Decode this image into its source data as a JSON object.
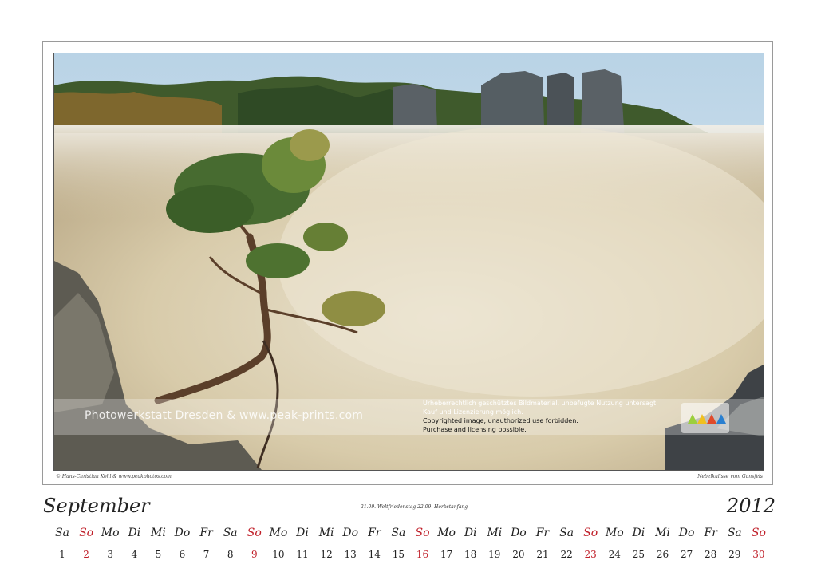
{
  "photo": {
    "watermark_left": "Photowerkstatt Dresden & www.peak-prints.com",
    "notice_de_1": "Urheberrechtlich geschütztes Bildmaterial, unbefugte Nutzung untersagt.",
    "notice_de_2": "Kauf und Lizenzierung möglich.",
    "notice_en_1": "Copyrighted image, unauthorized use forbidden.",
    "notice_en_2": "Purchase and licensing possible.",
    "logo_icon": "peak-prints-logo-icon"
  },
  "caption_left": "© Hans-Christian Kohl & www.peakphotos.com",
  "caption_right": "Nebelkulisse vom Gansfels",
  "month": "September",
  "holidays": "21.09. Weltfriedenstag  22.09. Herbstanfang",
  "year": "2012",
  "colors": {
    "sunday": "#c0202a",
    "text": "#222222"
  },
  "calendar": [
    {
      "wd": "Sa",
      "d": "1"
    },
    {
      "wd": "So",
      "d": "2"
    },
    {
      "wd": "Mo",
      "d": "3"
    },
    {
      "wd": "Di",
      "d": "4"
    },
    {
      "wd": "Mi",
      "d": "5"
    },
    {
      "wd": "Do",
      "d": "6"
    },
    {
      "wd": "Fr",
      "d": "7"
    },
    {
      "wd": "Sa",
      "d": "8"
    },
    {
      "wd": "So",
      "d": "9"
    },
    {
      "wd": "Mo",
      "d": "10"
    },
    {
      "wd": "Di",
      "d": "11"
    },
    {
      "wd": "Mi",
      "d": "12"
    },
    {
      "wd": "Do",
      "d": "13"
    },
    {
      "wd": "Fr",
      "d": "14"
    },
    {
      "wd": "Sa",
      "d": "15"
    },
    {
      "wd": "So",
      "d": "16"
    },
    {
      "wd": "Mo",
      "d": "17"
    },
    {
      "wd": "Di",
      "d": "18"
    },
    {
      "wd": "Mi",
      "d": "19"
    },
    {
      "wd": "Do",
      "d": "20"
    },
    {
      "wd": "Fr",
      "d": "21"
    },
    {
      "wd": "Sa",
      "d": "22"
    },
    {
      "wd": "So",
      "d": "23"
    },
    {
      "wd": "Mo",
      "d": "24"
    },
    {
      "wd": "Di",
      "d": "25"
    },
    {
      "wd": "Mi",
      "d": "26"
    },
    {
      "wd": "Do",
      "d": "27"
    },
    {
      "wd": "Fr",
      "d": "28"
    },
    {
      "wd": "Sa",
      "d": "29"
    },
    {
      "wd": "So",
      "d": "30"
    }
  ]
}
